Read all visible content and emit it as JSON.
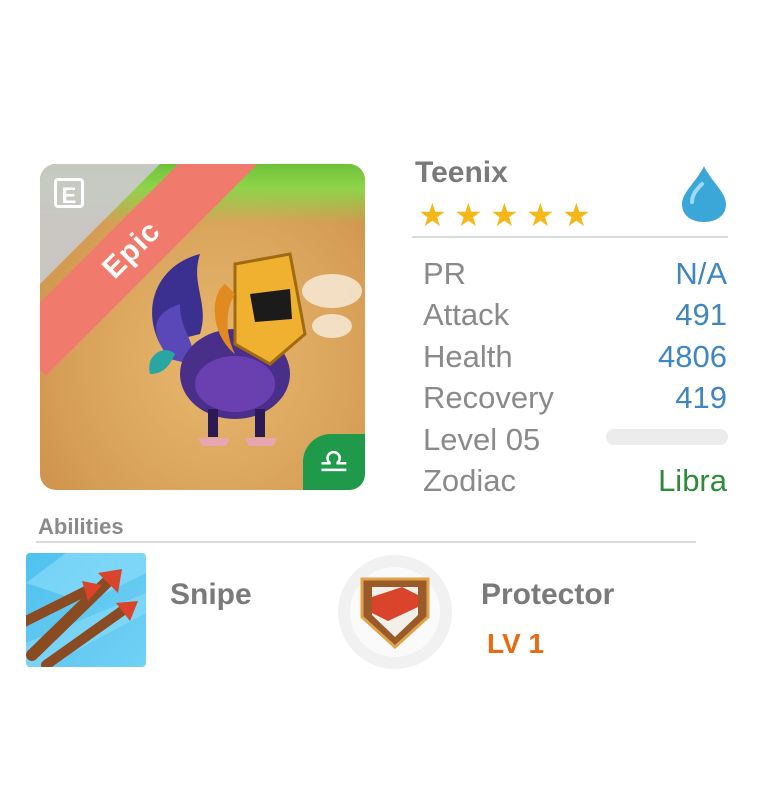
{
  "card": {
    "rarity": "Epic",
    "edition_badge": "E",
    "zodiac_badge_icon": "libra-icon",
    "zodiac_glyph": "♎"
  },
  "monster": {
    "name": "Teenix",
    "stars": 5,
    "element_icon": "water-drop-icon",
    "colors": {
      "star": "#f6b818",
      "value": "#3f86c2",
      "zodiac": "#2d8b3a"
    }
  },
  "stats": [
    {
      "label": "PR",
      "value": "N/A"
    },
    {
      "label": "Attack",
      "value": "491"
    },
    {
      "label": "Health",
      "value": "4806"
    },
    {
      "label": "Recovery",
      "value": "419"
    },
    {
      "label": "Level 05",
      "value": ""
    },
    {
      "label": "Zodiac",
      "value": "Libra"
    }
  ],
  "abilities": {
    "title": "Abilities",
    "items": [
      {
        "name": "Snipe",
        "icon": "arrows-icon"
      },
      {
        "name": "Protector",
        "level": "LV 1",
        "icon": "shield-icon"
      }
    ]
  }
}
